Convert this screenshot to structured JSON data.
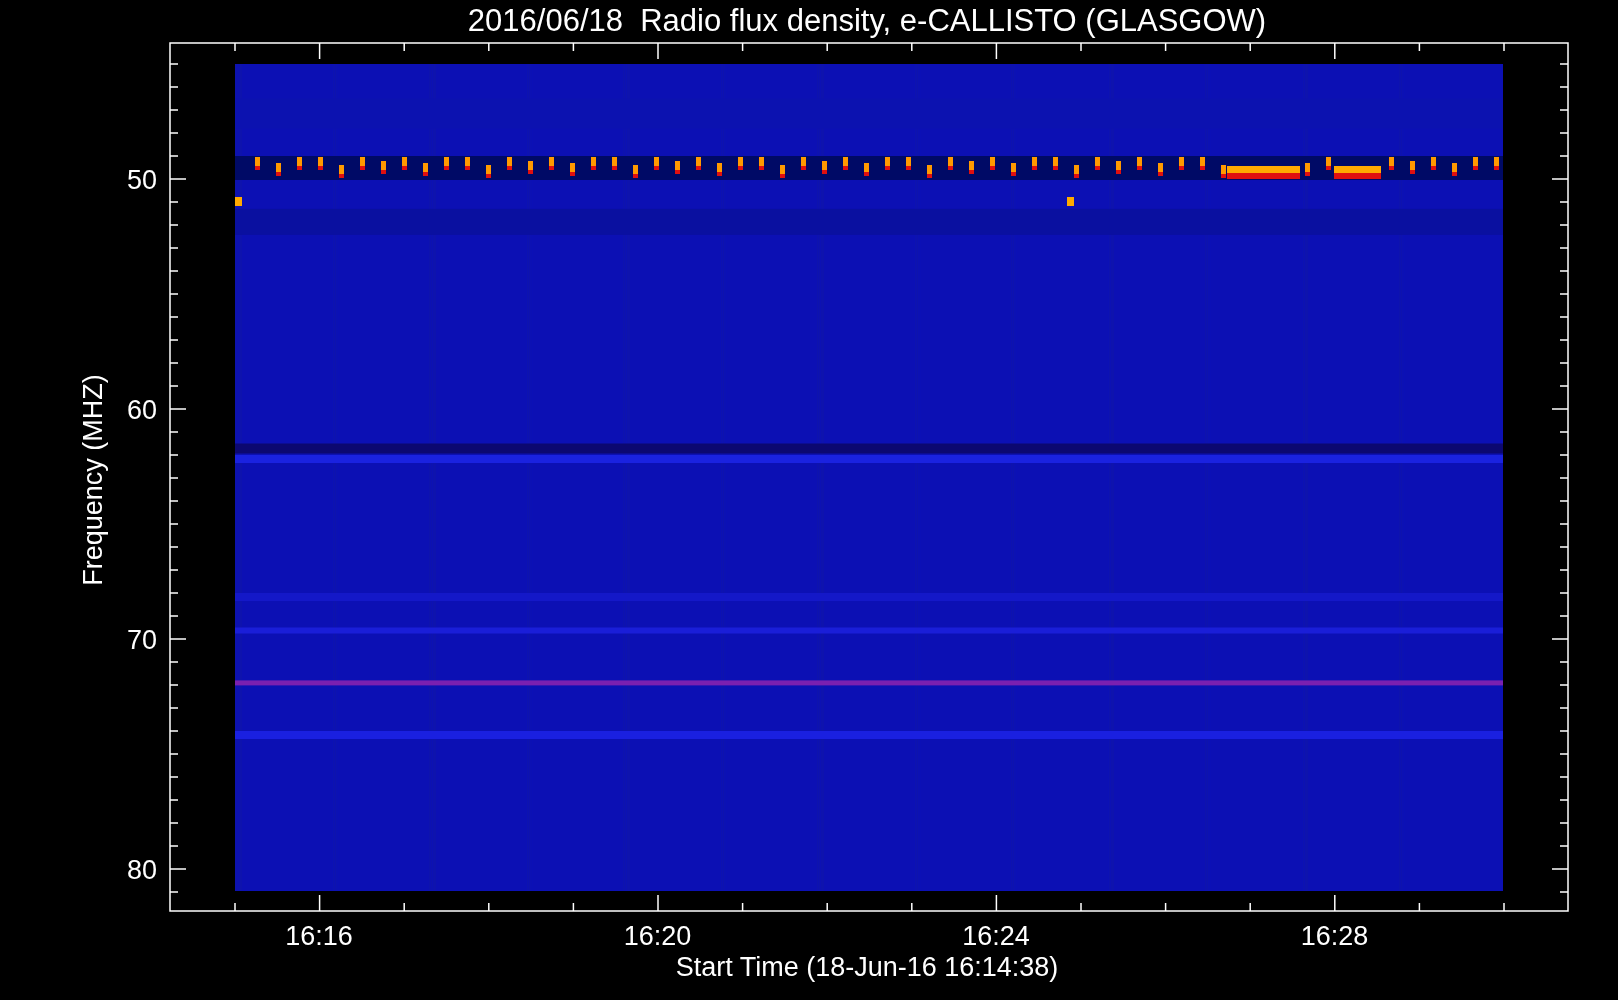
{
  "plot": {
    "title": "2016/06/18  Radio flux density, e-CALLISTO (GLASGOW)",
    "ylabel": "Frequency (MHZ)",
    "xlabel": "Start Time (18-Jun-16 16:14:38)",
    "yticks": [
      "50",
      "60",
      "70",
      "80"
    ],
    "xticks": [
      "16:16",
      "16:20",
      "16:24",
      "16:28"
    ]
  }
}
